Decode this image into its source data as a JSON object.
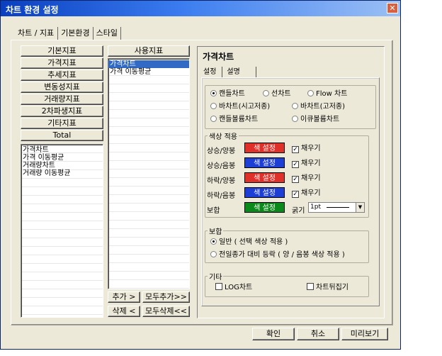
{
  "window": {
    "title": "차트 환경 설정",
    "close_label": "✕"
  },
  "tabs": [
    "차트 / 지표",
    "기본환경",
    "스타일"
  ],
  "left_buttons": [
    "기본지표",
    "가격지표",
    "추세지표",
    "변동성지표",
    "거래량지표",
    "2차파생지표",
    "기타지표",
    "Total"
  ],
  "left_list": [
    "가격차트",
    "가격 이동평균",
    "거래량차트",
    "거래량 이동평균"
  ],
  "used": {
    "header": "사용지표",
    "items": [
      {
        "label": "가격차트",
        "selected": true
      },
      {
        "label": "가격 이동평균",
        "selected": false
      }
    ]
  },
  "action_buttons": {
    "add": "추가 >",
    "add_all": "모두추가>>",
    "delete": "삭제 <",
    "delete_all": "모두삭제<<"
  },
  "right": {
    "title": "가격차트",
    "subtabs": [
      "설정",
      "설명"
    ],
    "chart_types": [
      {
        "label": "캔들차트",
        "checked": true
      },
      {
        "label": "선차트",
        "checked": false
      },
      {
        "label": "Flow 차트",
        "checked": false
      },
      {
        "label": "바차트(시고저종)",
        "checked": false
      },
      {
        "label": "바차트(고저종)",
        "checked": false
      },
      {
        "label": "캔들볼륨차트",
        "checked": false
      },
      {
        "label": "이큐볼륨차트",
        "checked": false
      }
    ],
    "color_group": {
      "label": "색상 적용",
      "rows": [
        {
          "label": "상승/양봉",
          "button": "색 설정",
          "color": "#e0302a",
          "fill_label": "채우기",
          "checked": true
        },
        {
          "label": "상승/음봉",
          "button": "색 설정",
          "color": "#1e3fd6",
          "fill_label": "채우기",
          "checked": true
        },
        {
          "label": "하락/양봉",
          "button": "색 설정",
          "color": "#e0302a",
          "fill_label": "채우기",
          "checked": true
        },
        {
          "label": "하락/음봉",
          "button": "색 설정",
          "color": "#1e3fd6",
          "fill_label": "채우기",
          "checked": true
        },
        {
          "label": "보합",
          "button": "색 설정",
          "color": "#0a8a1a"
        }
      ],
      "thickness_label": "굵기",
      "thickness_value": "1pt"
    },
    "flat_group": {
      "label": "보합",
      "options": [
        {
          "label": "일반 ( 선택 색상 적용 )",
          "checked": true
        },
        {
          "label": "전일종가 대비 등락 ( 양 / 음봉 색상 적용 )",
          "checked": false
        }
      ]
    },
    "etc_group": {
      "label": "기타",
      "log_label": "LOG차트",
      "invert_label": "차트뒤집기"
    }
  },
  "footer": {
    "ok": "확인",
    "cancel": "취소",
    "preview": "미리보기"
  }
}
